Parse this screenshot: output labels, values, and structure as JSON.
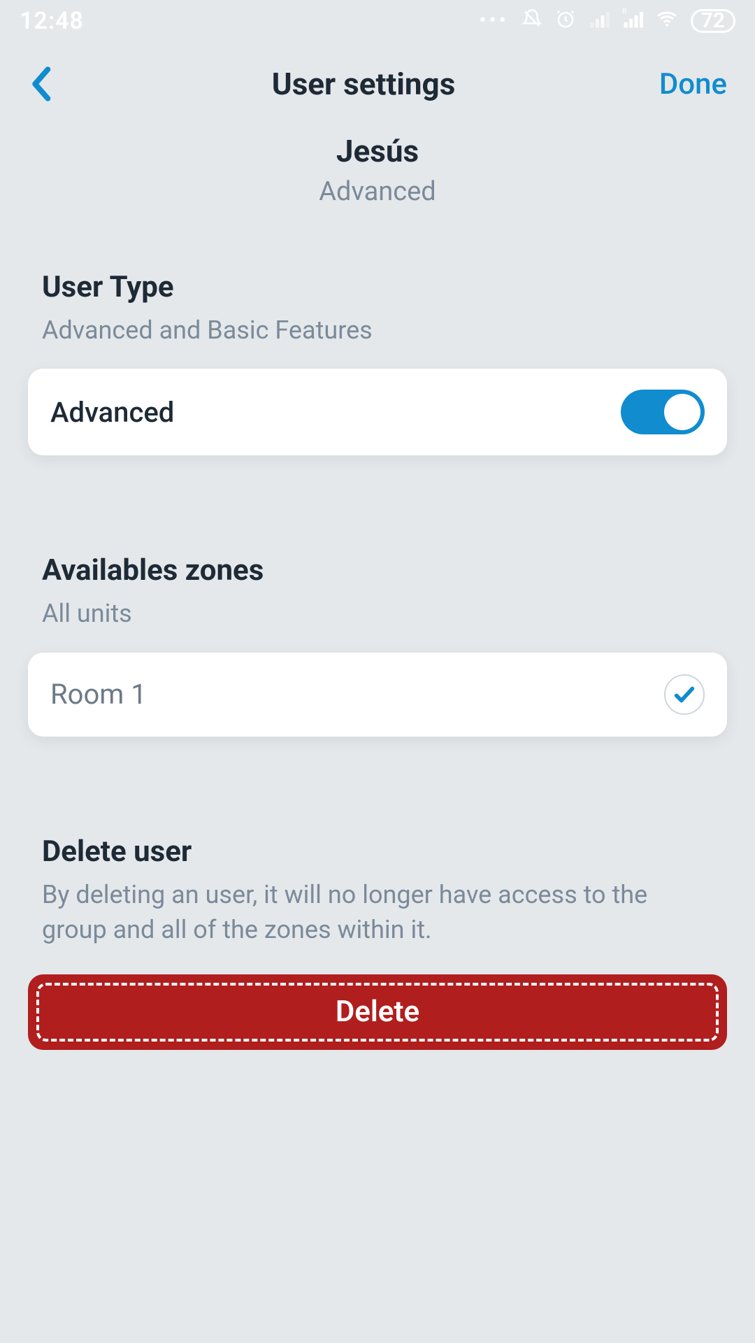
{
  "status": {
    "time": "12:48",
    "battery_level": "72"
  },
  "nav": {
    "title": "User settings",
    "done_label": "Done"
  },
  "user": {
    "name": "Jesús",
    "role": "Advanced"
  },
  "sections": {
    "user_type": {
      "title": "User Type",
      "subtitle": "Advanced and Basic Features",
      "toggle_label": "Advanced",
      "toggle_on": true
    },
    "zones": {
      "title": "Availables zones",
      "subtitle": "All units",
      "items": [
        {
          "label": "Room 1",
          "checked": true
        }
      ]
    },
    "delete": {
      "title": "Delete user",
      "subtitle": "By deleting an user, it will no longer have access to the group and all of the zones within it.",
      "button_label": "Delete"
    }
  }
}
